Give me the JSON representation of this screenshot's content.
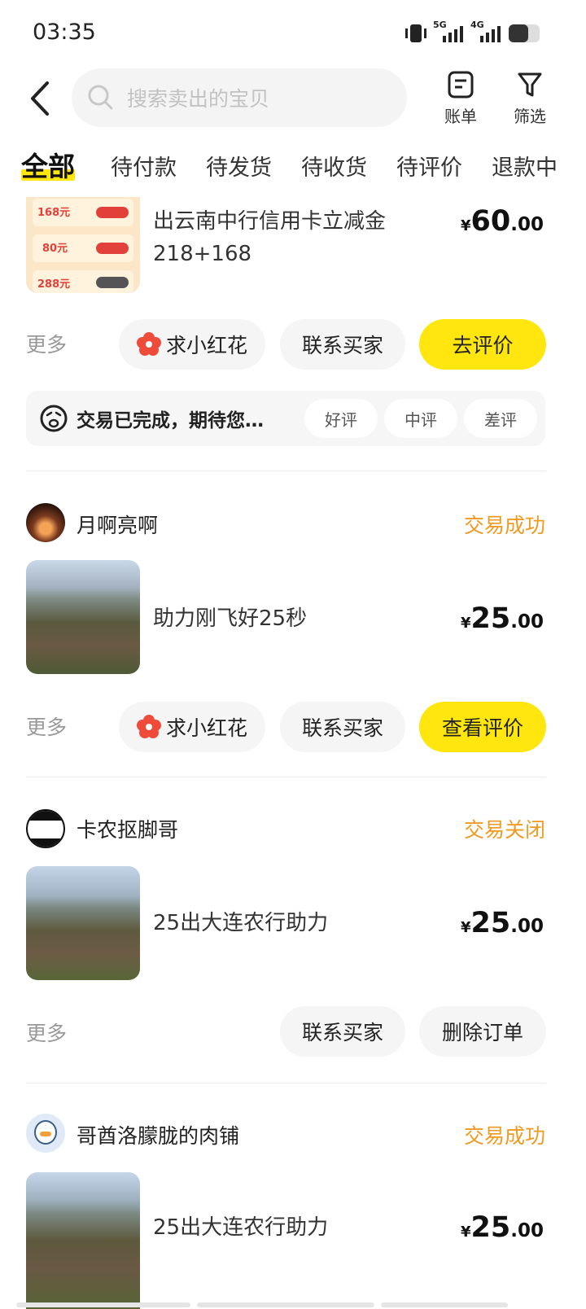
{
  "status_bar": {
    "time": "03:35",
    "network1": "5G",
    "network2": "4G"
  },
  "header": {
    "search_placeholder": "搜索卖出的宝贝",
    "bill_label": "账单",
    "filter_label": "筛选"
  },
  "tabs": [
    "全部",
    "待付款",
    "待发货",
    "待收货",
    "待评价",
    "退款中"
  ],
  "orders": [
    {
      "title_line1": "出云南中行信用卡立减金",
      "title_line2": "218+168",
      "price_symbol": "¥",
      "price_int": "60",
      "price_dec": ".00",
      "thumb_labels": [
        "168元",
        "80元",
        "288元"
      ],
      "more": "更多",
      "actions": [
        "求小红花",
        "联系买家",
        "去评价"
      ],
      "review_prompt": "交易已完成，期待您…",
      "review_options": [
        "好评",
        "中评",
        "差评"
      ]
    },
    {
      "seller": "月啊亮啊",
      "status": "交易成功",
      "title": "助力刚飞好25秒",
      "price_symbol": "¥",
      "price_int": "25",
      "price_dec": ".00",
      "more": "更多",
      "actions": [
        "求小红花",
        "联系买家",
        "查看评价"
      ]
    },
    {
      "seller": "卡农抠脚哥",
      "status": "交易关闭",
      "title": "25出大连农行助力",
      "price_symbol": "¥",
      "price_int": "25",
      "price_dec": ".00",
      "more": "更多",
      "actions": [
        "联系买家",
        "删除订单"
      ]
    },
    {
      "seller": "哥酋洛朦胧的肉铺",
      "status": "交易成功",
      "title": "25出大连农行助力",
      "price_symbol": "¥",
      "price_int": "25",
      "price_dec": ".00"
    }
  ],
  "colors": {
    "accent_yellow": "#ffe60f",
    "status_orange": "#f19a22"
  },
  "icons": [
    "back-arrow-icon",
    "search-icon",
    "bill-icon",
    "filter-icon",
    "flower-icon",
    "face-icon"
  ]
}
